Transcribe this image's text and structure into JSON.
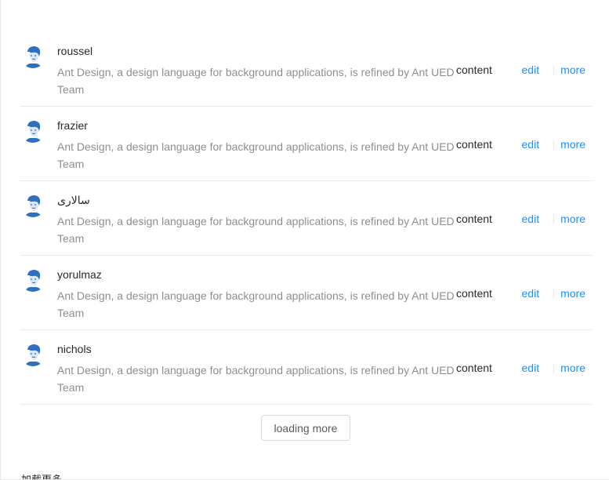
{
  "list": {
    "items": [
      {
        "title": "roussel",
        "description": "Ant Design, a design language for background applications, is refined by Ant UED Team",
        "content": "content",
        "actions": [
          "edit",
          "more"
        ]
      },
      {
        "title": "frazier",
        "description": "Ant Design, a design language for background applications, is refined by Ant UED Team",
        "content": "content",
        "actions": [
          "edit",
          "more"
        ]
      },
      {
        "title": "سالاری",
        "description": "Ant Design, a design language for background applications, is refined by Ant UED Team",
        "content": "content",
        "actions": [
          "edit",
          "more"
        ]
      },
      {
        "title": "yorulmaz",
        "description": "Ant Design, a design language for background applications, is refined by Ant UED Team",
        "content": "content",
        "actions": [
          "edit",
          "more"
        ]
      },
      {
        "title": "nichols",
        "description": "Ant Design, a design language for background applications, is refined by Ant UED Team",
        "content": "content",
        "actions": [
          "edit",
          "more"
        ]
      }
    ],
    "avatar_icon": "user-avatar-icon",
    "load_more_label": "loading more"
  },
  "footer": {
    "text": "加载更多 ..."
  },
  "colors": {
    "link": "#1890ff",
    "border": "#e8e8e8",
    "description": "rgba(0,0,0,0.45)"
  }
}
